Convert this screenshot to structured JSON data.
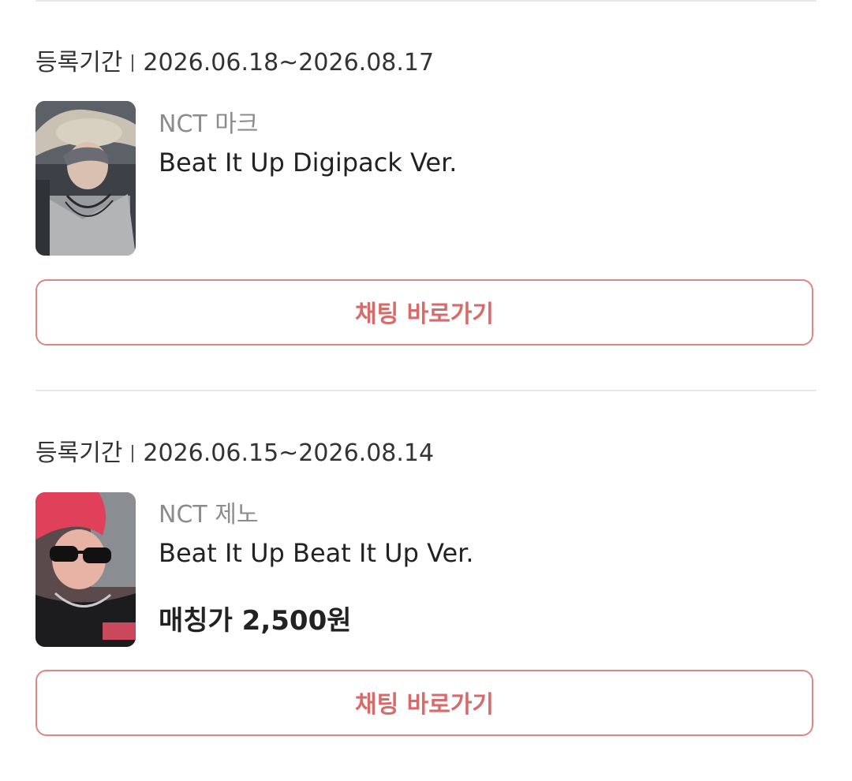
{
  "listings": [
    {
      "period_label": "등록기간",
      "period_value": "2026.06.18~2026.08.17",
      "artist": "NCT 마크",
      "album": "Beat It Up Digipack Ver.",
      "price": "",
      "chat_button": "채팅 바로가기"
    },
    {
      "period_label": "등록기간",
      "period_value": "2026.06.15~2026.08.14",
      "artist": "NCT 제노",
      "album": "Beat It Up Beat It Up Ver.",
      "price": "매칭가 2,500원",
      "chat_button": "채팅 바로가기"
    }
  ],
  "colors": {
    "button_border": "#e08484",
    "button_text": "#d86a6a",
    "divider": "#e6e6e6",
    "artist_text": "#8c8c8c"
  },
  "icons": [
    "photocard-thumbnail-mark",
    "photocard-thumbnail-jeno"
  ]
}
